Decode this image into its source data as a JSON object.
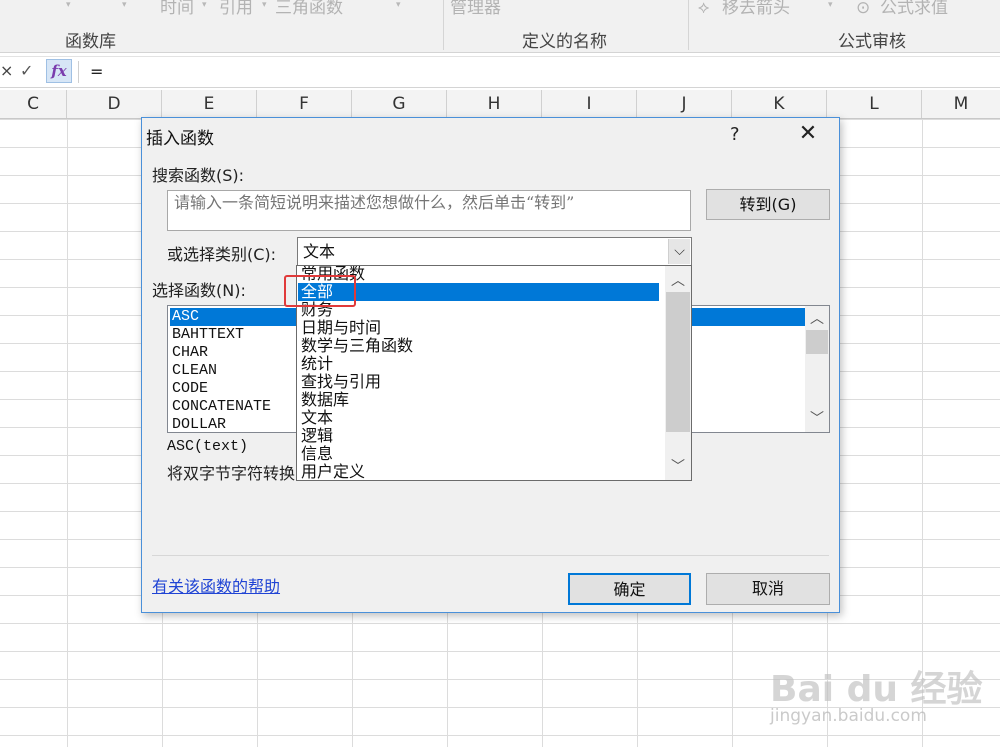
{
  "ribbon": {
    "top_items": [
      "时间",
      "引用",
      "三角函数",
      "管理器",
      "移去箭头",
      "公式求值"
    ],
    "groups": [
      "函数库",
      "定义的名称",
      "公式审核"
    ]
  },
  "formula_bar": {
    "cancel_symbol": "×",
    "enter_symbol": "✓",
    "fx_label": "fx",
    "content": "="
  },
  "sheet": {
    "columns": [
      "C",
      "D",
      "E",
      "F",
      "G",
      "H",
      "I",
      "J",
      "K",
      "L",
      "M"
    ]
  },
  "dialog": {
    "title": "插入函数",
    "help_symbol": "?",
    "close_symbol": "✕",
    "search_label": "搜索函数(S):",
    "search_placeholder": "请输入一条简短说明来描述您想做什么，然后单击“转到”",
    "goto_button": "转到(G)",
    "category_label": "或选择类别(C):",
    "category_value": "文本",
    "function_label": "选择函数(N):",
    "functions": [
      "ASC",
      "BAHTTEXT",
      "CHAR",
      "CLEAN",
      "CODE",
      "CONCATENATE",
      "DOLLAR"
    ],
    "selected_function": "ASC",
    "syntax": "ASC(text)",
    "description": "将双字节字符转换",
    "help_link": "有关该函数的帮助",
    "ok_button": "确定",
    "cancel_button": "取消"
  },
  "category_dropdown": {
    "options": [
      "常用函数",
      "全部",
      "财务",
      "日期与时间",
      "数学与三角函数",
      "统计",
      "查找与引用",
      "数据库",
      "文本",
      "逻辑",
      "信息",
      "用户定义"
    ],
    "highlighted": "全部"
  },
  "watermark": {
    "brand": "Bai du 经验",
    "url": "jingyan.baidu.com"
  },
  "colors": {
    "accent": "#0078d7",
    "annotation": "#e03a3a",
    "link": "#2044d4"
  }
}
